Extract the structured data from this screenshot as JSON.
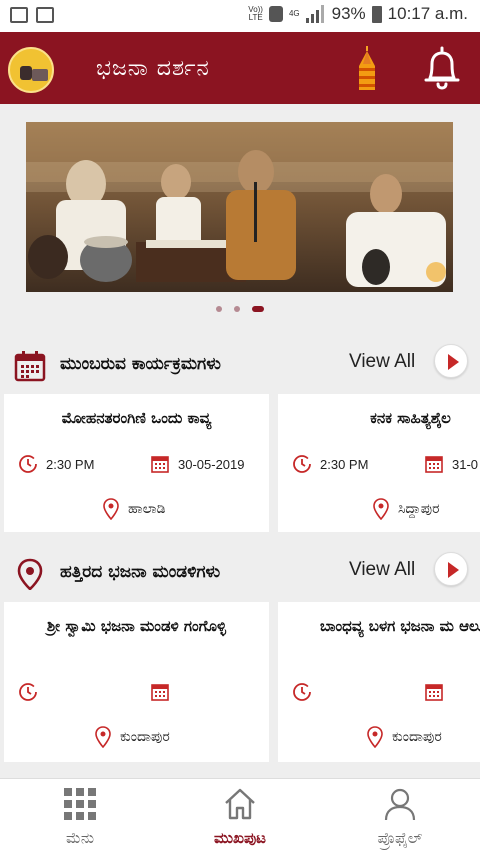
{
  "status_bar": {
    "volte_top": "Vo))",
    "volte_bottom": "LTE",
    "network": "4G",
    "battery": "93%",
    "time": "10:17 a.m."
  },
  "app_bar": {
    "title": "ಭಜನಾ ದರ್ಶನ",
    "logo_icon": "bhajan-logo-icon",
    "temple_icon": "temple-icon",
    "bell_icon": "bell-icon"
  },
  "banner": {
    "image_description_icon": "banner-image",
    "pages": 3,
    "active_page": 3
  },
  "upcoming": {
    "title": "ಮುಂಬರುವ ಕಾರ್ಯಕ್ರಮಗಳು",
    "view_all": "View All",
    "items": [
      {
        "title": "ಮೋಹನತರಂಗಿಣಿ ಒಂದು ಕಾವ್ಯ",
        "time": "2:30 PM",
        "date": "30-05-2019",
        "place": "ಹಾಲಾಡಿ"
      },
      {
        "title": "ಕನಕ ಸಾಹಿತ್ಯಶೈಲ",
        "time": "2:30 PM",
        "date": "31-0",
        "place": "ಸಿದ್ದಾಪುರ"
      }
    ]
  },
  "nearby": {
    "title": "ಹತ್ತಿರದ ಭಜನಾ ಮಂಡಳಿಗಳು",
    "view_all": "View All",
    "items": [
      {
        "title": "ಶ್ರೀ ಸ್ವಾಮಿ ಭಜನಾ ಮಂಡಳಿ ಗಂಗೊಳ್ಳಿ",
        "place": "ಕುಂದಾಪುರ"
      },
      {
        "title": "ಬಾಂಧವ್ಯ ಬಳಗ ಭಜನಾ ಮ ಆಲೂರು",
        "place": "ಕುಂದಾಪುರ"
      }
    ]
  },
  "bottom_nav": {
    "items": [
      {
        "label": "ಮೆನು",
        "icon": "grid-icon"
      },
      {
        "label": "ಮುಖಪುಟ",
        "icon": "home-icon"
      },
      {
        "label": "ಪ್ರೊಫೈಲ್",
        "icon": "profile-icon"
      }
    ],
    "active": "ಮುಖಪುಟ"
  },
  "colors": {
    "brand": "#8b1421",
    "accent_red": "#c62828",
    "background": "#eeeeee"
  }
}
